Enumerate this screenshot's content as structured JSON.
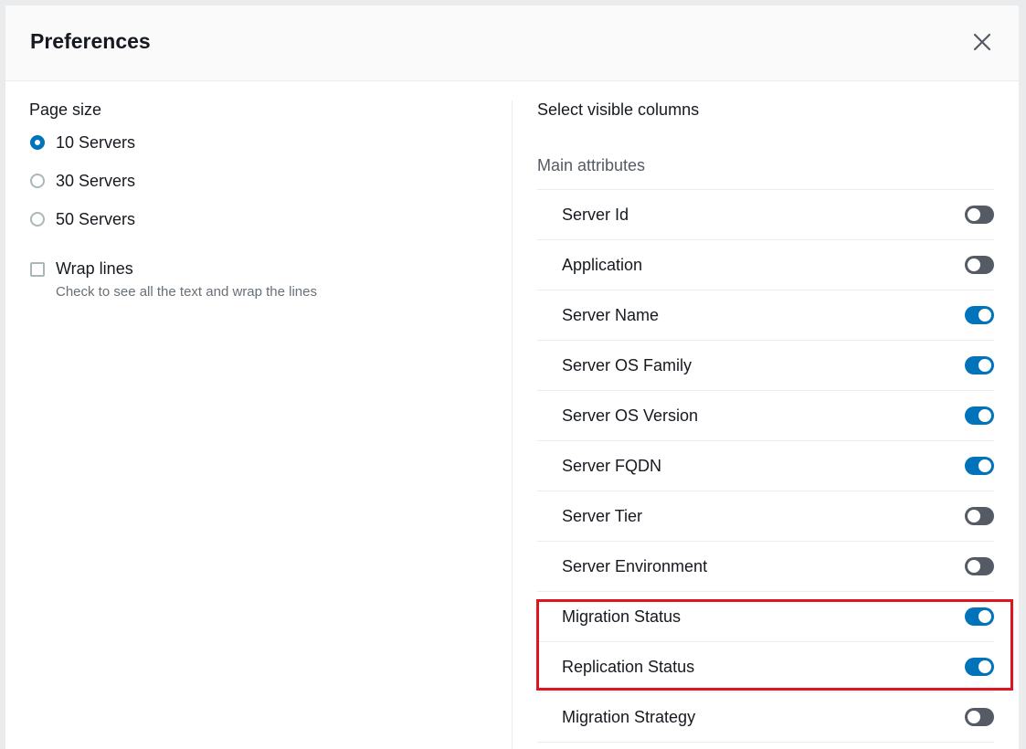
{
  "dialog": {
    "title": "Preferences",
    "close_icon": "close-icon"
  },
  "page_size": {
    "label": "Page size",
    "options": [
      {
        "label": "10 Servers",
        "checked": true
      },
      {
        "label": "30 Servers",
        "checked": false
      },
      {
        "label": "50 Servers",
        "checked": false
      }
    ]
  },
  "wrap_lines": {
    "label": "Wrap lines",
    "description": "Check to see all the text and wrap the lines",
    "checked": false
  },
  "visible_columns": {
    "label": "Select visible columns",
    "group_label": "Main attributes",
    "columns": [
      {
        "label": "Server Id",
        "enabled": false
      },
      {
        "label": "Application",
        "enabled": false
      },
      {
        "label": "Server Name",
        "enabled": true
      },
      {
        "label": "Server OS Family",
        "enabled": true
      },
      {
        "label": "Server OS Version",
        "enabled": true
      },
      {
        "label": "Server FQDN",
        "enabled": true
      },
      {
        "label": "Server Tier",
        "enabled": false
      },
      {
        "label": "Server Environment",
        "enabled": false
      },
      {
        "label": "Migration Status",
        "enabled": true
      },
      {
        "label": "Replication Status",
        "enabled": true
      },
      {
        "label": "Migration Strategy",
        "enabled": false
      }
    ]
  },
  "colors": {
    "accent": "#0073bb",
    "toggle_off": "#545b64",
    "highlight": "#e0131f"
  }
}
